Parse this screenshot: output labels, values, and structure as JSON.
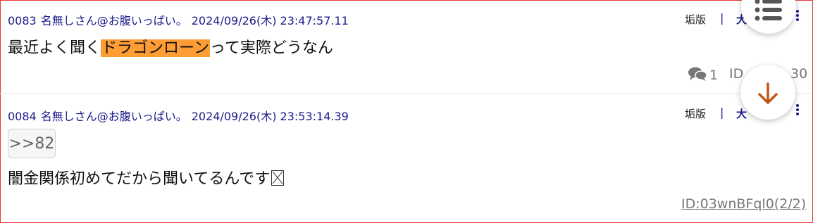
{
  "posts": [
    {
      "number": "0083",
      "name": "名無しさん@お腹いっぱい。",
      "datetime": "2024/09/26(木) 23:47:57.11",
      "board_label": "垢版",
      "separator": "|",
      "tab_label": "大",
      "body_before": "最近よく聞く",
      "body_highlight": "ドラゴンローン",
      "body_after": "って実際どうなん",
      "reply_count": "1",
      "id_label": "ID",
      "id_tail": "30"
    },
    {
      "number": "0084",
      "name": "名無しさん@お腹いっぱい。",
      "datetime": "2024/09/26(木) 23:53:14.39",
      "board_label": "垢版",
      "separator": "|",
      "tab_label": "大",
      "anchor": ">>82",
      "body": "闇金関係初めてだから聞いてるんです",
      "id_link": "ID:03wnBFql0(2/2)"
    }
  ],
  "colors": {
    "highlight": "#ff9c33",
    "meta_text": "#1a1a8c",
    "fab_arrow": "#c2571a",
    "border": "#e53935"
  },
  "icons": {
    "menu_fab": "list-icon",
    "down_fab": "arrow-down-icon",
    "replies": "speech-bubbles-icon",
    "more": "kebab-icon"
  }
}
